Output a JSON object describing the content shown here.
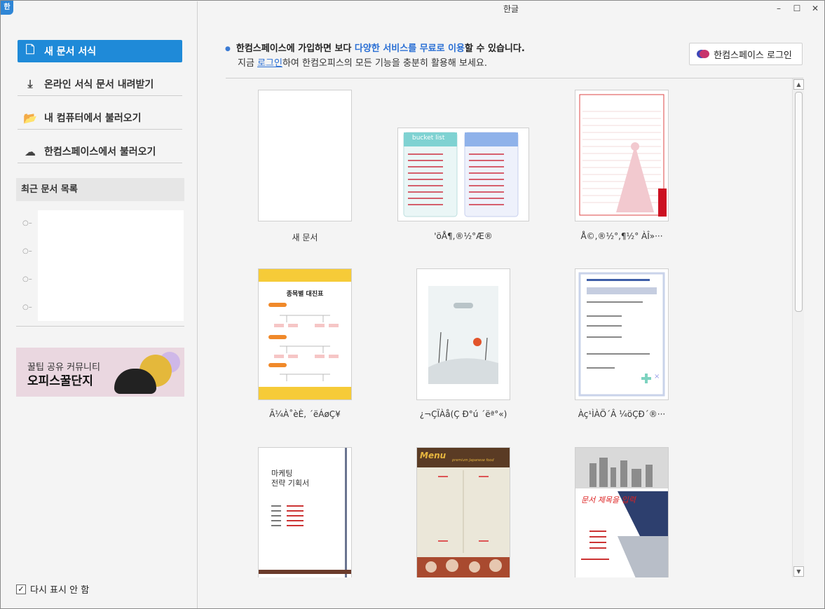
{
  "window": {
    "title": "한글",
    "app_icon": "한"
  },
  "window_controls": {
    "minimize": "–",
    "maximize": "☐",
    "close": "✕"
  },
  "sidebar": {
    "items": [
      {
        "label": "새 문서 서식",
        "icon": "document-icon",
        "glyph": "🗋"
      },
      {
        "label": "온라인 서식 문서 내려받기",
        "icon": "download-icon",
        "glyph": "⤓"
      },
      {
        "label": "내 컴퓨터에서 불러오기",
        "icon": "folder-icon",
        "glyph": "📂"
      },
      {
        "label": "한컴스페이스에서 불러오기",
        "icon": "cloud-icon",
        "glyph": "☁"
      }
    ],
    "recent_header": "최근 문서 목록",
    "banner": {
      "line1": "꿀팁 공유 커뮤니티",
      "line2": "오피스꿀단지"
    },
    "dont_show_again": "다시 표시 안 함",
    "dont_show_checked": true
  },
  "notice": {
    "line1_a": "한컴스페이스에 가입하면 보다 ",
    "line1_link": "다양한 서비스를 무료로 이용",
    "line1_b": "할 수 있습니다.",
    "line2_a": "지금 ",
    "line2_link": "로그인",
    "line2_b": "하여 한컴오피스의 모든 기능을 충분히 활용해 보세요."
  },
  "login_button": "한컴스페이스 로그인",
  "templates": [
    {
      "label": "새 문서"
    },
    {
      "label": "'öÅ¶,®½°Æ®",
      "text": "bucket list"
    },
    {
      "label": "Å©,®½°,¶½° ÀÎ»···"
    },
    {
      "label": "Ã¼À˚èÈ, ´ëÁøÇ¥",
      "text": "종목별 대진표"
    },
    {
      "label": "¿¬ÇÏÀå(Ç Ð°ú ´ëª°«)"
    },
    {
      "label": "Àç¹ÌÀÖ´Â ¼öÇÐ´®···"
    },
    {
      "label": "",
      "text1": "마케팅",
      "text2": "전략 기획서"
    },
    {
      "label": "",
      "text1": "Menu",
      "text2": "premium Japanese food"
    },
    {
      "label": "",
      "text1": "문서 제목을 입력"
    }
  ],
  "colors": {
    "accent": "#1f8ad8",
    "link": "#2a6fd4"
  }
}
